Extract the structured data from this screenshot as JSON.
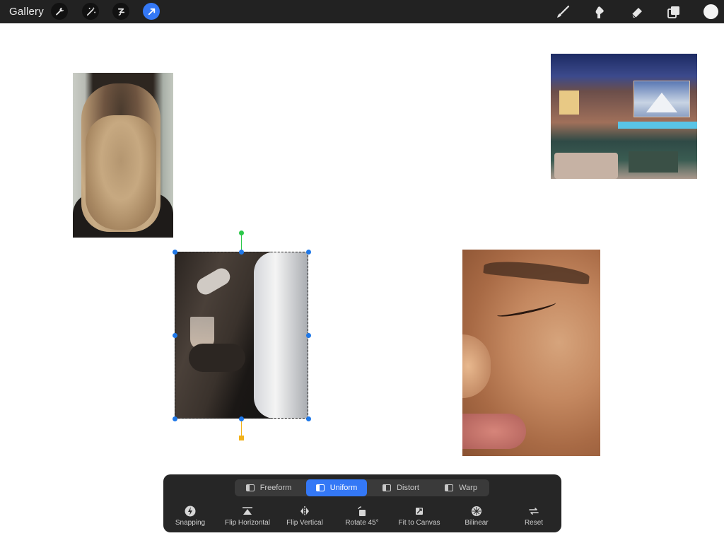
{
  "topbar": {
    "gallery_label": "Gallery",
    "left_tools": [
      "wrench-icon",
      "magic-wand-icon",
      "selection-icon",
      "transform-arrow-icon"
    ],
    "right_tools": [
      "brush-icon",
      "smudge-icon",
      "eraser-icon",
      "layers-icon",
      "color-icon"
    ],
    "active_tool": "transform-arrow-icon",
    "current_color": "#f4f4f4"
  },
  "transform": {
    "modes": [
      {
        "label": "Freeform",
        "active": false
      },
      {
        "label": "Uniform",
        "active": true
      },
      {
        "label": "Distort",
        "active": false
      },
      {
        "label": "Warp",
        "active": false
      }
    ],
    "actions": [
      {
        "label": "Snapping",
        "icon": "lightning-icon"
      },
      {
        "label": "Flip Horizontal",
        "icon": "flip-horizontal-icon"
      },
      {
        "label": "Flip Vertical",
        "icon": "flip-vertical-icon"
      },
      {
        "label": "Rotate 45°",
        "icon": "rotate-icon"
      },
      {
        "label": "Fit to Canvas",
        "icon": "fit-canvas-icon"
      },
      {
        "label": "Bilinear",
        "icon": "bilinear-icon"
      },
      {
        "label": "Reset",
        "icon": "reset-icon"
      }
    ]
  },
  "colors": {
    "accent": "#3478f6",
    "handle": "#1f78e8",
    "rotation_handle": "#2cc84a",
    "adjust_handle": "#f2b21b",
    "topbar_bg": "#222222",
    "toolbar_bg": "#262626"
  }
}
